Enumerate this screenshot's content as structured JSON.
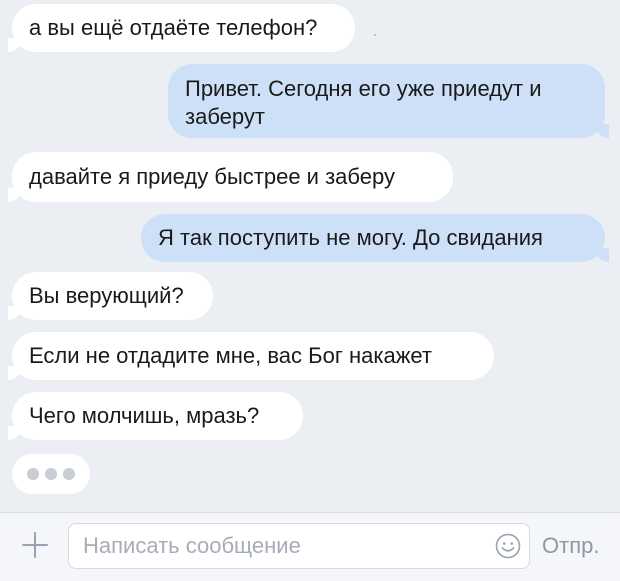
{
  "messages": [
    {
      "id": "m1",
      "direction": "incoming",
      "text": "а вы ещё отдаёте телефон?"
    },
    {
      "id": "m2",
      "direction": "outgoing",
      "text": "Привет. Сегодня его уже приедут и заберут"
    },
    {
      "id": "m3",
      "direction": "incoming",
      "text": "давайте я приеду быстрее и заберу"
    },
    {
      "id": "m4",
      "direction": "outgoing",
      "text": "Я так поступить не могу. До свидания"
    },
    {
      "id": "m5",
      "direction": "incoming",
      "text": "Вы верующий?"
    },
    {
      "id": "m6",
      "direction": "incoming",
      "text": "Если не отдадите мне, вас Бог накажет"
    },
    {
      "id": "m7",
      "direction": "incoming",
      "text": "Чего молчишь, мразь?"
    }
  ],
  "typing_indicator": {
    "icon": "typing-dots-icon"
  },
  "composer": {
    "attach_icon": "plus-icon",
    "placeholder": "Написать сообщение",
    "emoji_icon": "smile-icon",
    "send_label": "Отпр."
  },
  "colors": {
    "background": "#ebeef3",
    "incoming_bubble": "#ffffff",
    "outgoing_bubble": "#cee0f7",
    "muted_text": "#a7adb7"
  }
}
